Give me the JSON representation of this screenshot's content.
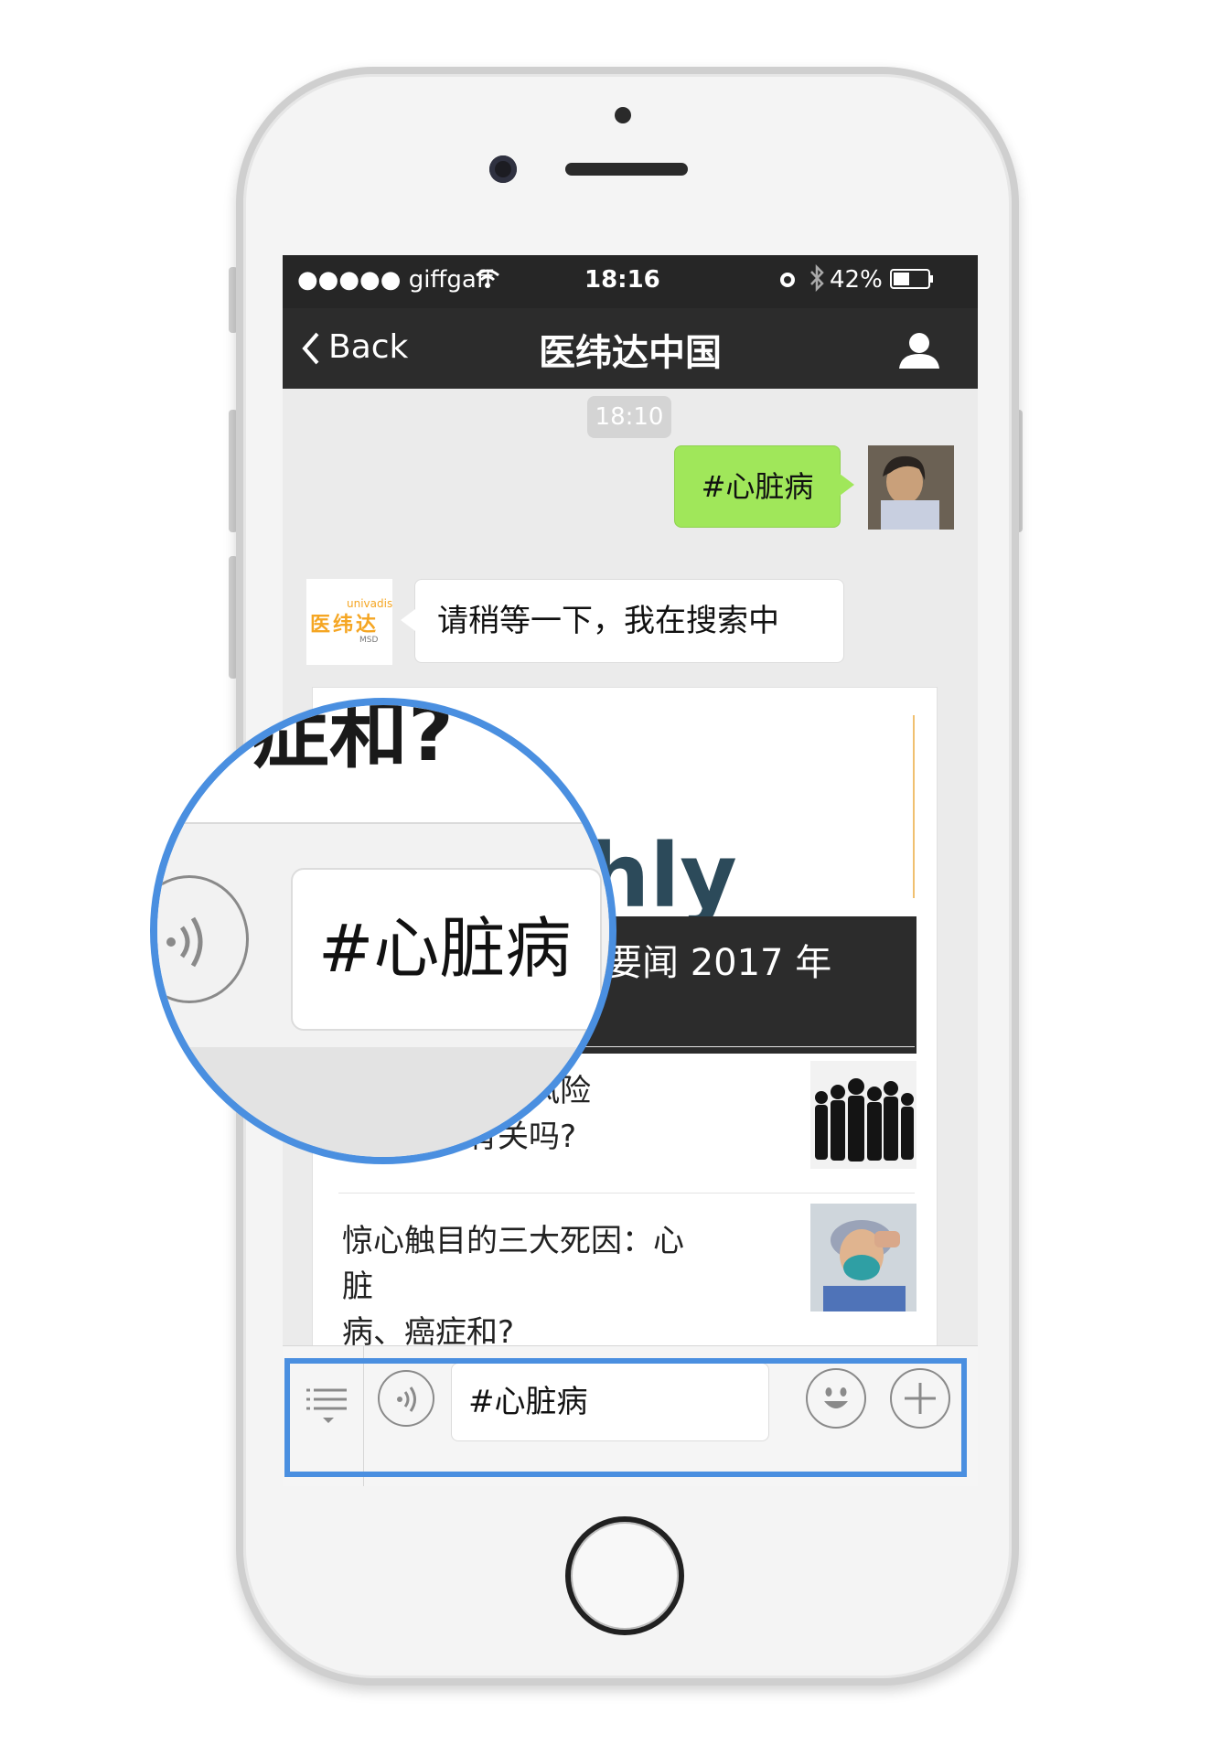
{
  "status_bar": {
    "carrier": "●●●●● giffgaff",
    "time": "18:16",
    "battery": "42%"
  },
  "nav": {
    "back_label": "Back",
    "title": "医纬达中国"
  },
  "chat": {
    "timestamp": "18:10",
    "my_message": "#心脏病",
    "bot_reply": "请稍等一下，我在搜索中",
    "bot_logo": {
      "top": "univadis",
      "main": "医纬达",
      "sub": "MSD"
    }
  },
  "article_card": {
    "banner_partial_text": "hly",
    "banner_caption": "要闻 2017 年",
    "items": [
      {
        "title_line1": "糖尿病和癌症风险",
        "title_line2": "都和身高有关吗?"
      },
      {
        "title_line1": "惊心触目的三大死因：心脏",
        "title_line2": "病、癌症和?"
      }
    ]
  },
  "input_bar": {
    "text_value": "#心脏病"
  },
  "magnifier": {
    "top_text": "症和?",
    "field_text": "#心脏病"
  },
  "colors": {
    "accent": "#4a8fe0",
    "bubble_green": "#a0e75a",
    "nav_bg": "#2c2c2c"
  }
}
